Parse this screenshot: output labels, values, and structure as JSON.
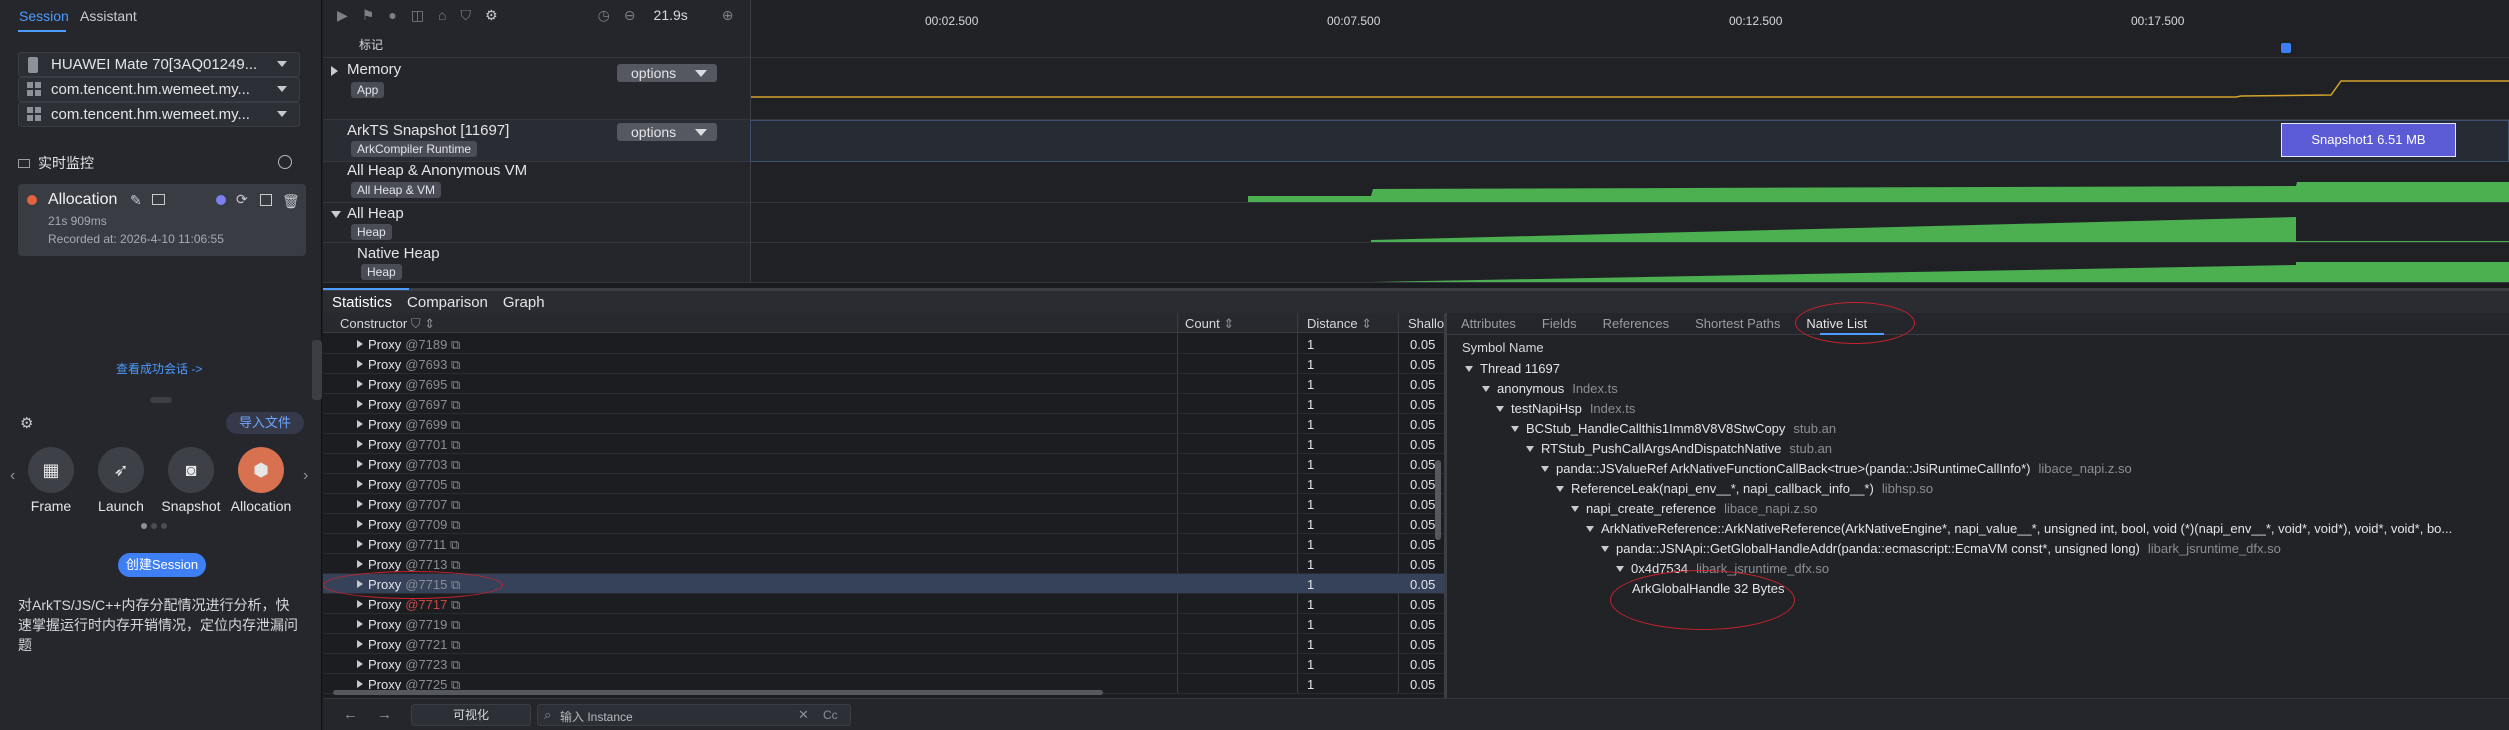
{
  "left": {
    "tabs": [
      "Session",
      "Assistant"
    ],
    "devices": [
      {
        "label": "HUAWEI Mate 70[3AQ01249...",
        "icon": "phone-icon"
      },
      {
        "label": "com.tencent.hm.wemeet.my...",
        "icon": "grid-icon"
      },
      {
        "label": "com.tencent.hm.wemeet.my...",
        "icon": "grid-icon"
      }
    ],
    "monitor_title": "实时监控",
    "allocation": {
      "title": "Allocation",
      "duration": "21s 909ms",
      "recorded": "Recorded at: 2026-4-10 11:06:55"
    },
    "view_sessions_link": "查看成功会话 ->",
    "import_file": "导入文件",
    "tools": [
      "Frame",
      "Launch",
      "Snapshot",
      "Allocation"
    ],
    "create_session": "创建Session",
    "description": "对ArkTS/JS/C++内存分配情况进行分析，快速掌握运行时内存开销情况，定位内存泄漏问题"
  },
  "toolbar": {
    "time": "21.9s"
  },
  "ruler": {
    "ticks": [
      "00:02.500",
      "00:07.500",
      "00:12.500",
      "00:17.500"
    ],
    "marker_label": "标记"
  },
  "tracks": [
    {
      "name": "Memory",
      "sub": "App",
      "options": "options"
    },
    {
      "name": "ArkTS Snapshot [11697]",
      "sub": "ArkCompiler Runtime",
      "options": "options"
    },
    {
      "name": "All Heap & Anonymous VM",
      "sub": "All Heap & VM"
    },
    {
      "name": "All Heap",
      "sub": "Heap"
    },
    {
      "name": "Native Heap",
      "sub": "Heap"
    }
  ],
  "snapshot_badge": "Snapshot1 6.51 MB",
  "bottom_tabs": [
    "Statistics",
    "Comparison",
    "Graph"
  ],
  "table": {
    "headers": [
      "Constructor",
      "Count",
      "Distance",
      "Shallo"
    ],
    "rows": [
      {
        "name": "Proxy",
        "id": "@7189",
        "distance": "1",
        "shallow": "0.05"
      },
      {
        "name": "Proxy",
        "id": "@7693",
        "distance": "1",
        "shallow": "0.05"
      },
      {
        "name": "Proxy",
        "id": "@7695",
        "distance": "1",
        "shallow": "0.05"
      },
      {
        "name": "Proxy",
        "id": "@7697",
        "distance": "1",
        "shallow": "0.05"
      },
      {
        "name": "Proxy",
        "id": "@7699",
        "distance": "1",
        "shallow": "0.05"
      },
      {
        "name": "Proxy",
        "id": "@7701",
        "distance": "1",
        "shallow": "0.05"
      },
      {
        "name": "Proxy",
        "id": "@7703",
        "distance": "1",
        "shallow": "0.05"
      },
      {
        "name": "Proxy",
        "id": "@7705",
        "distance": "1",
        "shallow": "0.05"
      },
      {
        "name": "Proxy",
        "id": "@7707",
        "distance": "1",
        "shallow": "0.05"
      },
      {
        "name": "Proxy",
        "id": "@7709",
        "distance": "1",
        "shallow": "0.05"
      },
      {
        "name": "Proxy",
        "id": "@7711",
        "distance": "1",
        "shallow": "0.05"
      },
      {
        "name": "Proxy",
        "id": "@7713",
        "distance": "1",
        "shallow": "0.05"
      },
      {
        "name": "Proxy",
        "id": "@7715",
        "distance": "1",
        "shallow": "0.05"
      },
      {
        "name": "Proxy",
        "id": "@7717",
        "distance": "1",
        "shallow": "0.05"
      },
      {
        "name": "Proxy",
        "id": "@7719",
        "distance": "1",
        "shallow": "0.05"
      },
      {
        "name": "Proxy",
        "id": "@7721",
        "distance": "1",
        "shallow": "0.05"
      },
      {
        "name": "Proxy",
        "id": "@7723",
        "distance": "1",
        "shallow": "0.05"
      },
      {
        "name": "Proxy",
        "id": "@7725",
        "distance": "1",
        "shallow": "0.05"
      }
    ]
  },
  "right_tabs": [
    "Attributes",
    "Fields",
    "References",
    "Shortest Paths",
    "Native List"
  ],
  "symbol_header": "Symbol Name",
  "native_tree": [
    {
      "name": "Thread 11697",
      "src": ""
    },
    {
      "name": "anonymous",
      "src": "Index.ts"
    },
    {
      "name": "testNapiHsp",
      "src": "Index.ts"
    },
    {
      "name": "BCStub_HandleCallthis1Imm8V8V8StwCopy",
      "src": "stub.an"
    },
    {
      "name": "RTStub_PushCallArgsAndDispatchNative",
      "src": "stub.an"
    },
    {
      "name": "panda::JSValueRef ArkNativeFunctionCallBack<true>(panda::JsiRuntimeCallInfo*)",
      "src": "libace_napi.z.so"
    },
    {
      "name": "ReferenceLeak(napi_env__*, napi_callback_info__*)",
      "src": "libhsp.so"
    },
    {
      "name": "napi_create_reference",
      "src": "libace_napi.z.so"
    },
    {
      "name": "ArkNativeReference::ArkNativeReference(ArkNativeEngine*, napi_value__*, unsigned int, bool, void (*)(napi_env__*, void*, void*), void*, void*, bo...",
      "src": ""
    },
    {
      "name": "panda::JSNApi::GetGlobalHandleAddr(panda::ecmascript::EcmaVM const*, unsigned long)",
      "src": "libark_jsruntime_dfx.so"
    },
    {
      "name": "0x4d7534",
      "src": "libark_jsruntime_dfx.so"
    },
    {
      "name": "ArkGlobalHandle 32 Bytes",
      "src": ""
    }
  ],
  "footer": {
    "visualize": "可视化",
    "search_placeholder": "输入 Instance",
    "case": "Cc"
  }
}
